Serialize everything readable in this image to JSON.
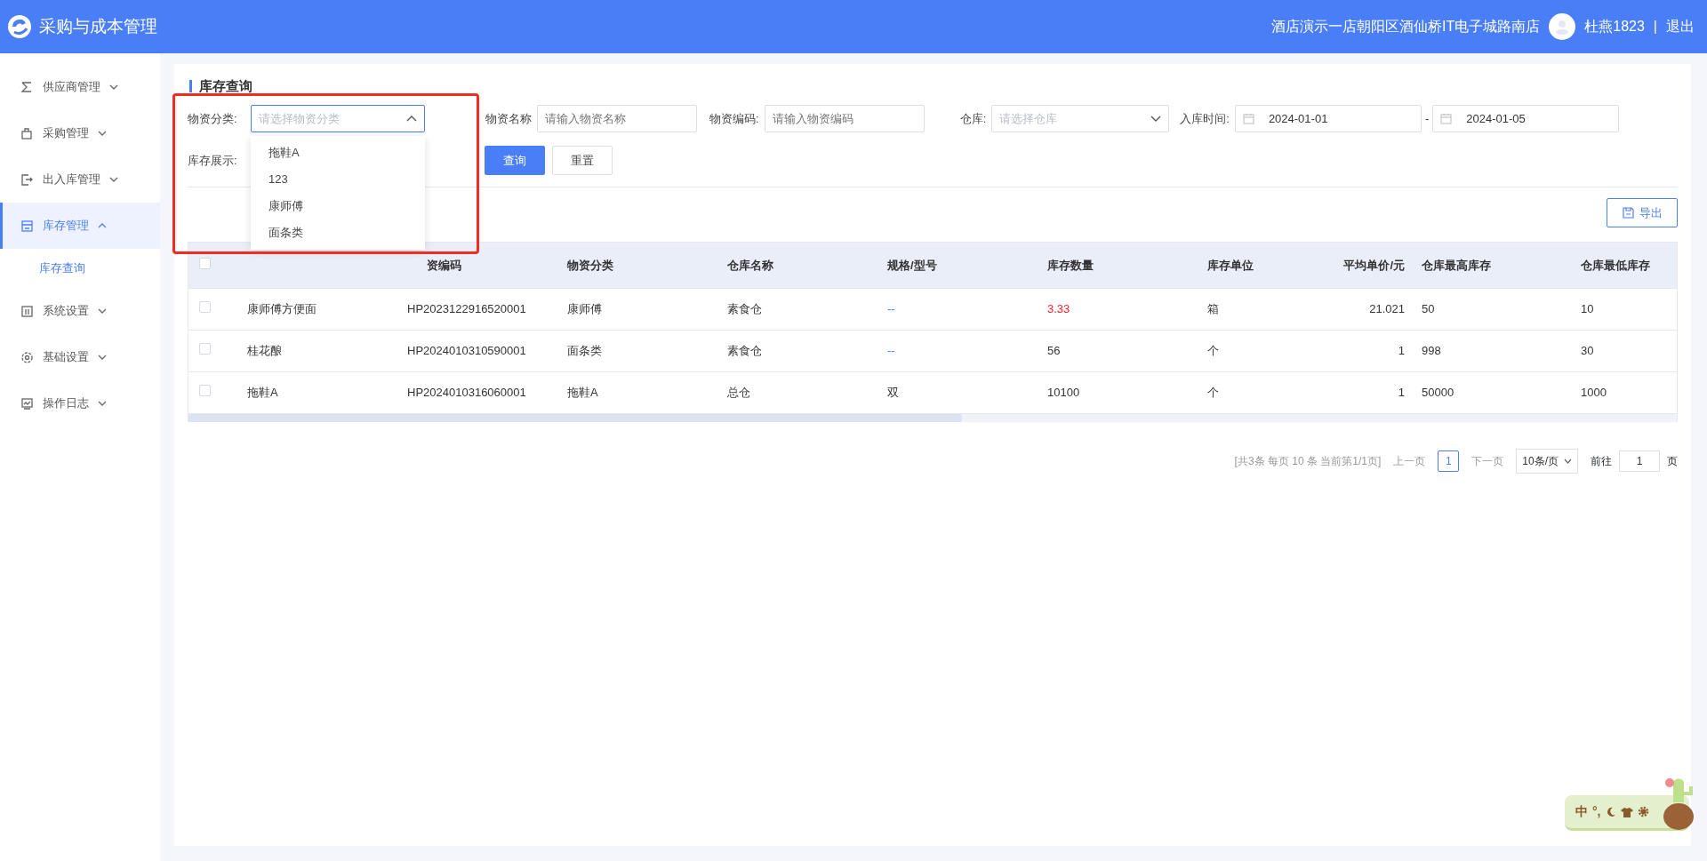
{
  "header": {
    "app_title": "采购与成本管理",
    "store": "酒店演示一店朝阳区酒仙桥IT电子城路南店",
    "user": "杜燕1823",
    "separator": "|",
    "logout": "退出"
  },
  "sidebar": {
    "items": [
      {
        "label": "供应商管理",
        "expanded": false,
        "selected": false
      },
      {
        "label": "采购管理",
        "expanded": false,
        "selected": false
      },
      {
        "label": "出入库管理",
        "expanded": false,
        "selected": false
      },
      {
        "label": "库存管理",
        "expanded": true,
        "selected": true,
        "children": [
          {
            "label": "库存查询",
            "selected": true
          }
        ]
      },
      {
        "label": "系统设置",
        "expanded": false,
        "selected": false
      },
      {
        "label": "基础设置",
        "expanded": false,
        "selected": false
      },
      {
        "label": "操作日志",
        "expanded": false,
        "selected": false
      }
    ]
  },
  "page_title": "库存查询",
  "filters": [
    {
      "kind": "select",
      "label": "物资分类:",
      "placeholder": "请选择物资分类",
      "open": true
    },
    {
      "kind": "input",
      "label": "物资名称",
      "placeholder": "请输入物资名称"
    },
    {
      "kind": "input",
      "label": "物资编码:",
      "placeholder": "请输入物资编码"
    },
    {
      "kind": "select",
      "label": "仓库:",
      "placeholder": "请选择仓库",
      "open": false
    },
    {
      "kind": "daterange",
      "label": "入库时间:",
      "from": "2024-01-01",
      "separator": "-",
      "to": "2024-01-05"
    }
  ],
  "stock_display_label": "库存展示:",
  "buttons": {
    "query": "查询",
    "reset": "重置",
    "export": "导出"
  },
  "dropdown": {
    "options": [
      "拖鞋A",
      "123",
      "康师傅",
      "面条类"
    ]
  },
  "table": {
    "header_checked": false,
    "columns": [
      null,
      "资编码",
      "物资分类",
      "仓库名称",
      "规格/型号",
      "库存数量",
      "库存单位",
      "平均单价/元",
      "仓库最高库存",
      "仓库最低库存"
    ],
    "rows": [
      {
        "checked": false,
        "low_stock": true,
        "cells": [
          "康师傅方便面",
          "HP2023122916520001",
          "康师傅",
          "素食仓",
          "--",
          "3.33",
          "箱",
          "21.021",
          "50",
          "10"
        ]
      },
      {
        "checked": false,
        "low_stock": false,
        "cells": [
          "桂花酿",
          "HP2024010310590001",
          "面条类",
          "素食仓",
          "--",
          "56",
          "个",
          "1",
          "998",
          "30"
        ]
      },
      {
        "checked": false,
        "low_stock": false,
        "cells": [
          "拖鞋A",
          "HP2024010316060001",
          "拖鞋A",
          "总仓",
          "双",
          "10100",
          "个",
          "1",
          "50000",
          "1000"
        ]
      }
    ]
  },
  "pagination": {
    "summary": "[共3条 每页 10 条 当前第1/1页]",
    "prev": "上一页",
    "pages": [
      {
        "label": "1",
        "selected": true
      }
    ],
    "next": "下一页",
    "page_size": "10条/页",
    "goto_label": "前往",
    "goto_value": "1",
    "goto_suffix": "页"
  },
  "ime_toolbar": {
    "mode": "中",
    "punct": "°,"
  }
}
